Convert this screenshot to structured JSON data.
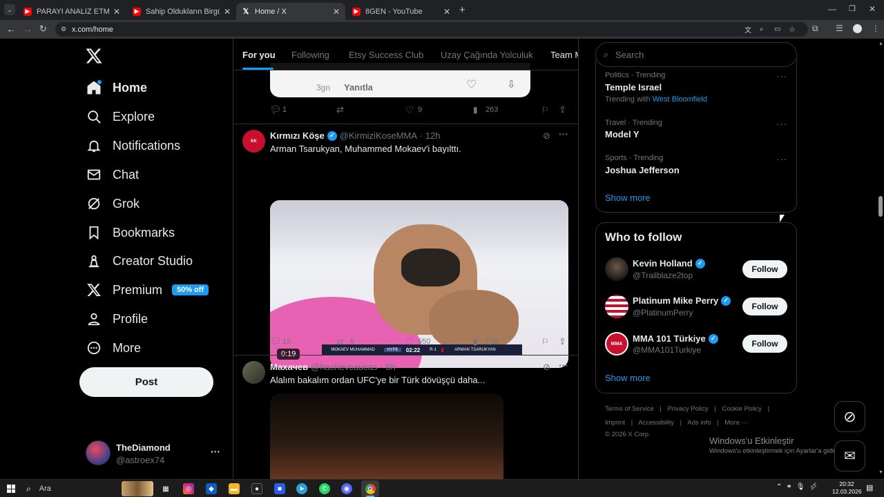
{
  "browser": {
    "tabs": [
      {
        "title": "PARAYI ANALİZ ETMEK - YouTube",
        "icon": "youtube-icon",
        "active": false
      },
      {
        "title": "Sahip Oldukların Birgün Sana S...",
        "icon": "youtube-icon",
        "active": false
      },
      {
        "title": "Home / X",
        "icon": "x-logo-icon",
        "active": true
      },
      {
        "title": "8GEN - YouTube",
        "icon": "youtube-icon",
        "active": false
      }
    ],
    "new_tab": "+",
    "url": "x.com/home"
  },
  "sidebar": {
    "items": [
      {
        "label": "Home",
        "icon": "home-icon",
        "current": true
      },
      {
        "label": "Explore",
        "icon": "search-icon"
      },
      {
        "label": "Notifications",
        "icon": "bell-icon"
      },
      {
        "label": "Chat",
        "icon": "mail-icon"
      },
      {
        "label": "Grok",
        "icon": "grok-icon"
      },
      {
        "label": "Bookmarks",
        "icon": "bookmark-icon"
      },
      {
        "label": "Creator Studio",
        "icon": "creator-studio-icon"
      },
      {
        "label": "Premium",
        "icon": "x-logo-icon",
        "badge": "50% off"
      },
      {
        "label": "Profile",
        "icon": "person-icon"
      },
      {
        "label": "More",
        "icon": "more-circle-icon"
      }
    ],
    "post_button": "Post",
    "account": {
      "name": "TheDiamond",
      "handle": "@astroex74",
      "menu": "···"
    }
  },
  "feed": {
    "tabs": [
      "For you",
      "Following",
      "Etsy Success Club",
      "Uzay Çağında Yolculuk",
      "Team M"
    ],
    "quoted_partial": {
      "time": "3gn",
      "reply": "Yanıtla"
    },
    "post0_actions": {
      "replies": "1",
      "reposts": "",
      "likes": "9",
      "views": "263"
    },
    "posts": [
      {
        "name": "Kırmızı Köşe",
        "handle": "@KirmiziKoseMMA",
        "time": "· 12h",
        "text": "Arman Tsarukyan, Muhammed Mokaev'i bayılttı.",
        "video_duration": "0:19",
        "scoreboard": {
          "left": "MOKAEV MUHAMMAD",
          "time": "02:22",
          "round": "R-1",
          "right": "ARMAN TSARUKYAN"
        },
        "replies": "15",
        "reposts": "6",
        "likes": "550",
        "views": "71K"
      },
      {
        "name": "Махачев",
        "handle": "@hachevcaucas",
        "time": "· 6h",
        "text": "Alalım bakalım ordan UFC'ye bir Türk dövüşçü daha..."
      }
    ]
  },
  "right": {
    "search_placeholder": "Search",
    "trends": [
      {
        "meta": "Politics · Trending",
        "name": "Temple Israel",
        "extra_prefix": "Trending with",
        "extra_link": "West Bloomfield"
      },
      {
        "meta": "Travel · Trending",
        "name": "Model Y"
      },
      {
        "meta": "Sports · Trending",
        "name": "Joshua Jefferson"
      }
    ],
    "show_more": "Show more",
    "who_to_follow": {
      "title": "Who to follow",
      "accounts": [
        {
          "name": "Kevin Holland",
          "handle": "@Trailblaze2top",
          "button": "Follow"
        },
        {
          "name": "Platinum Mike Perry",
          "handle": "@PlatinumPerry",
          "button": "Follow"
        },
        {
          "name": "MMA 101 Türkiye",
          "handle": "@MMA101Turkiye",
          "button": "Follow"
        }
      ],
      "show_more": "Show more"
    },
    "footer": {
      "links1": [
        "Terms of Service",
        "Privacy Policy",
        "Cookie Policy"
      ],
      "links2": [
        "Imprint",
        "Accessibility",
        "Ads info",
        "More ···"
      ],
      "copyright": "© 2026 X Corp."
    }
  },
  "watermark": {
    "line1": "Windows'u Etkinleştir",
    "line2": "Windows'u etkinleştirmek için Ayarlar'a gidin."
  },
  "taskbar": {
    "search_label": "Ara",
    "time": "20:32",
    "date": "12.03.2026"
  },
  "colors": {
    "accent": "#1d9bf0",
    "background": "#000000",
    "premium_badge": "#1d9bf0"
  }
}
